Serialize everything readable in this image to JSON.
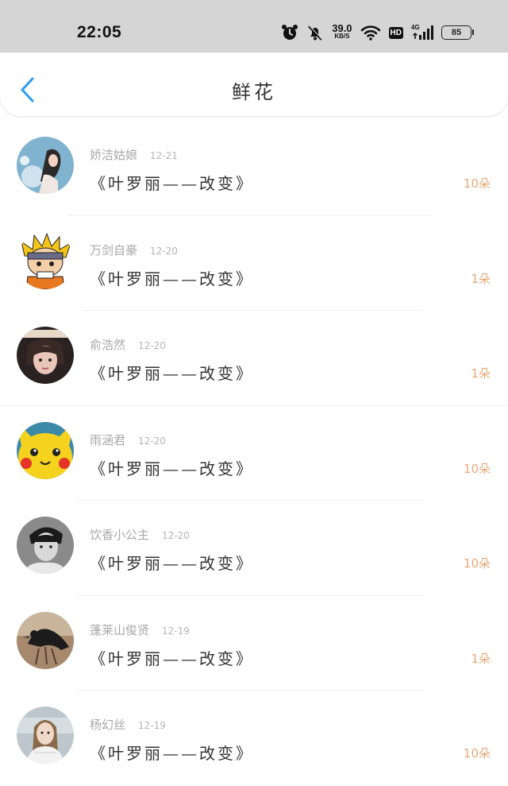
{
  "status_bar": {
    "time": "22:05",
    "net_speed_value": "39.0",
    "net_speed_unit": "KB/S",
    "hd_label": "HD",
    "network_type": "4G",
    "battery_level": "85"
  },
  "header": {
    "title": "鲜花"
  },
  "items": [
    {
      "username": "娇洁姑娘",
      "date": "12-21",
      "book": "《叶罗丽——改变》",
      "count": "10朵"
    },
    {
      "username": "万剑自豪",
      "date": "12-20",
      "book": "《叶罗丽——改变》",
      "count": "1朵"
    },
    {
      "username": "俞浩然",
      "date": "12-20",
      "book": "《叶罗丽——改变》",
      "count": "1朵"
    },
    {
      "username": "雨涵君",
      "date": "12-20",
      "book": "《叶罗丽——改变》",
      "count": "10朵"
    },
    {
      "username": "饮香小公主",
      "date": "12-20",
      "book": "《叶罗丽——改变》",
      "count": "10朵"
    },
    {
      "username": "蓬莱山俊贤",
      "date": "12-19",
      "book": "《叶罗丽——改变》",
      "count": "1朵"
    },
    {
      "username": "杨幻丝",
      "date": "12-19",
      "book": "《叶罗丽——改变》",
      "count": "10朵"
    }
  ],
  "colors": {
    "accent": "#2a9df4",
    "count": "#e7a978",
    "status_bar_bg": "#d5d5d5"
  }
}
